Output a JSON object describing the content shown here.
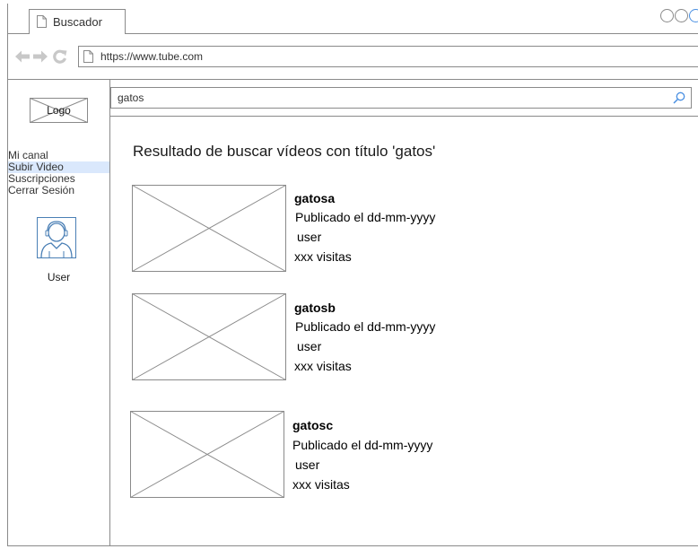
{
  "browser": {
    "tab_title": "Buscador",
    "url": "https://www.tube.com"
  },
  "sidebar": {
    "logo_label": "Logo",
    "menu": [
      {
        "label": "Mi canal"
      },
      {
        "label": "Subir Video"
      },
      {
        "label": "Suscripciones"
      },
      {
        "label": "Cerrar Sesión"
      }
    ],
    "user_label": "User"
  },
  "search": {
    "value": "gatos"
  },
  "results": {
    "heading": "Resultado de buscar vídeos con título 'gatos'",
    "items": [
      {
        "title": "gatosa",
        "published": "Publicado el dd-mm-yyyy",
        "user": "user",
        "views": "xxx visitas"
      },
      {
        "title": "gatosb",
        "published": "Publicado el dd-mm-yyyy",
        "user": "user",
        "views": "xxx visitas"
      },
      {
        "title": "gatosc",
        "published": "Publicado el dd-mm-yyyy",
        "user": "user",
        "views": "xxx visitas"
      }
    ]
  },
  "colors": {
    "border": "#8a8a8a",
    "active_menu_bg": "#dae8fc",
    "accent": "#4a90e2"
  },
  "icons": [
    "page-icon",
    "back-arrow-icon",
    "forward-arrow-icon",
    "refresh-icon",
    "search-icon",
    "user-avatar-icon",
    "image-placeholder-icon"
  ]
}
